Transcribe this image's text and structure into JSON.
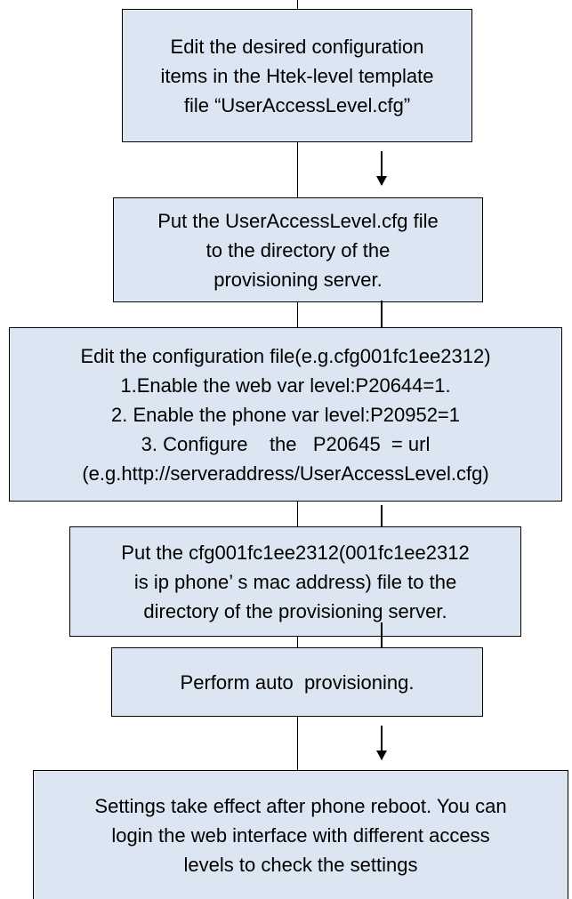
{
  "steps": [
    {
      "lines": [
        "Edit the desired configuration",
        "items in the Htek-level template",
        "file “UserAccessLevel.cfg”"
      ]
    },
    {
      "lines": [
        "Put the UserAccessLevel.cfg file",
        "to the directory of the",
        "provisioning server."
      ]
    },
    {
      "lines": [
        "Edit the configuration file(e.g.cfg001fc1ee2312)",
        "1.Enable the web var level:P20644=1.",
        "2. Enable the phone var level:P20952=1",
        "3. Configure    the   P20645  = url",
        "(e.g.http://serveraddress/UserAccessLevel.cfg)"
      ]
    },
    {
      "lines": [
        "Put the cfg001fc1ee2312(001fc1ee2312",
        "is ip phone’ s mac address) file to the",
        "directory of the provisioning server."
      ]
    },
    {
      "lines": [
        "Perform auto  provisioning."
      ]
    },
    {
      "lines": [
        "Settings take effect after phone reboot. You can",
        "login the web interface with different access",
        "levels to check the settings"
      ]
    }
  ]
}
